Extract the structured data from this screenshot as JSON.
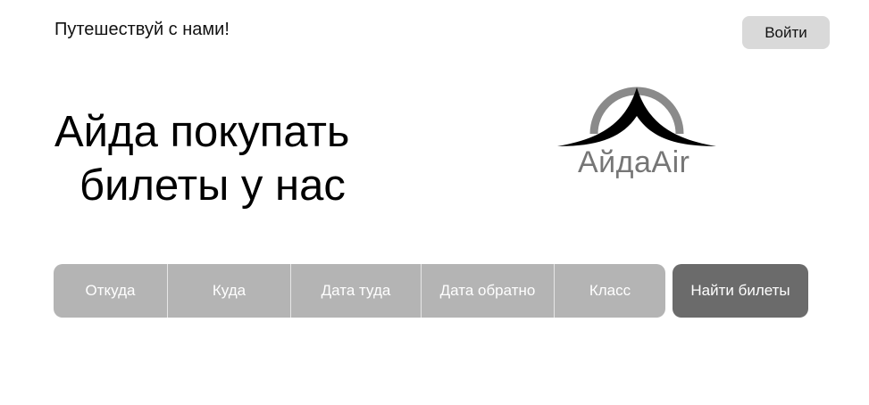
{
  "header": {
    "tagline": "Путешествуй с нами!",
    "login_label": "Войти"
  },
  "hero": {
    "title_line1": "Айда покупать",
    "title_line2": "билеты у нас"
  },
  "logo": {
    "text": "АйдаAir",
    "colors": {
      "arc": "#8a8a8a",
      "wings": "#000000",
      "text": "#767676"
    }
  },
  "search": {
    "fields": [
      {
        "label": "Откуда"
      },
      {
        "label": "Куда"
      },
      {
        "label": "Дата туда"
      },
      {
        "label": "Дата обратно"
      },
      {
        "label": "Класс"
      }
    ],
    "submit_label": "Найти билеты",
    "colors": {
      "bar": "#b4b4b4",
      "submit": "#6b6b6b"
    }
  }
}
